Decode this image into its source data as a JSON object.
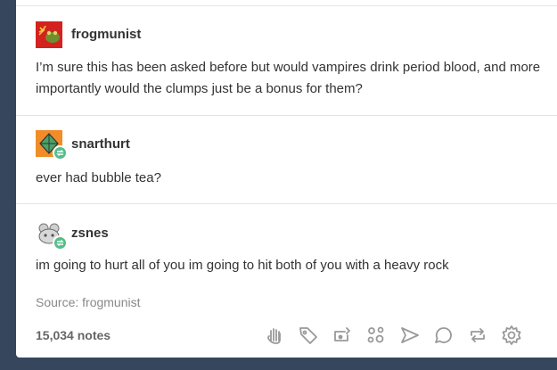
{
  "posts": [
    {
      "username": "frogmunist",
      "avatar": "soviet-frog-avatar",
      "text": "I’m sure this has been asked before but would vampires drink period blood, and more importantly would the clumps just be a bonus for them?"
    },
    {
      "username": "snarthurt",
      "avatar": "orange-diamond-avatar",
      "text": "ever had bubble tea?"
    },
    {
      "username": "zsnes",
      "avatar": "gray-controller-avatar",
      "text": "im going to hurt all of you im going to hit both of you with a heavy rock"
    }
  ],
  "source": "Source: frogmunist",
  "notes": "15,034 notes",
  "actions": [
    "hand-icon",
    "tag-icon",
    "queue-eye-icon",
    "circles-icon",
    "share-icon",
    "reply-icon",
    "reblog-icon",
    "settings-icon"
  ],
  "colors": {
    "background": "#36465d",
    "card": "#ffffff",
    "reblog_badge": "#56bc8a",
    "text": "#333333",
    "muted": "#888888"
  }
}
